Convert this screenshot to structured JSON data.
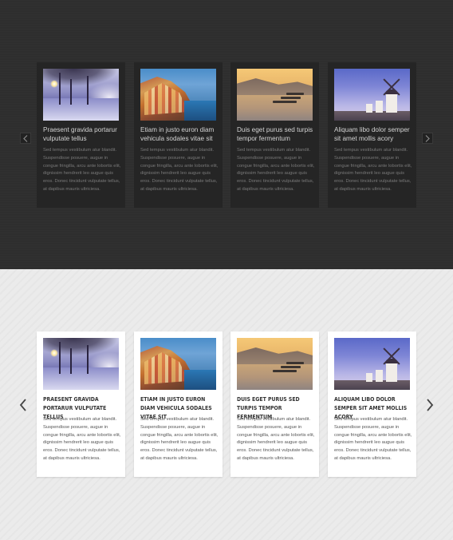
{
  "cards": [
    {
      "title": "Praesent gravida portarur vulputate tellus",
      "title_upper": "Praesent gravida portarur vulputate tellus",
      "image": "winter-road-photo"
    },
    {
      "title": "Etiam in justo euron diam vehicula sodales vitae sit",
      "title_upper": "Etiam in justo euron diam vehicula sodales vitae sit",
      "image": "coastal-village-photo"
    },
    {
      "title": "Duis eget purus sed turpis tempor fermentum",
      "title_upper": "Duis eget purus sed turpis tempor fermentum",
      "image": "lake-boats-photo"
    },
    {
      "title": "Aliquam libo dolor semper sit amet mollis acory",
      "title_upper": "Aliquam libo dolor semper sit amet mollis acory",
      "image": "windmill-photo"
    }
  ],
  "card_description": "Sed tempus vestibulum atur blandit. Suspendisse posuere, augue in congue fringilla, arcu ante lobortis elit, dignissim hendrerit leo augue quis eros. Donec tincidunt vulputate tellus, at dapibus mauris ultriciesa.",
  "dark": {
    "prev_icon": "chevron-left-icon",
    "next_icon": "chevron-right-icon"
  },
  "light": {
    "prev_icon": "chevron-left-icon",
    "next_icon": "chevron-right-icon"
  },
  "colors": {
    "dark_bg": "#2e2e2e",
    "dark_card": "#252525",
    "light_bg": "#ebebeb",
    "light_card": "#ffffff"
  }
}
